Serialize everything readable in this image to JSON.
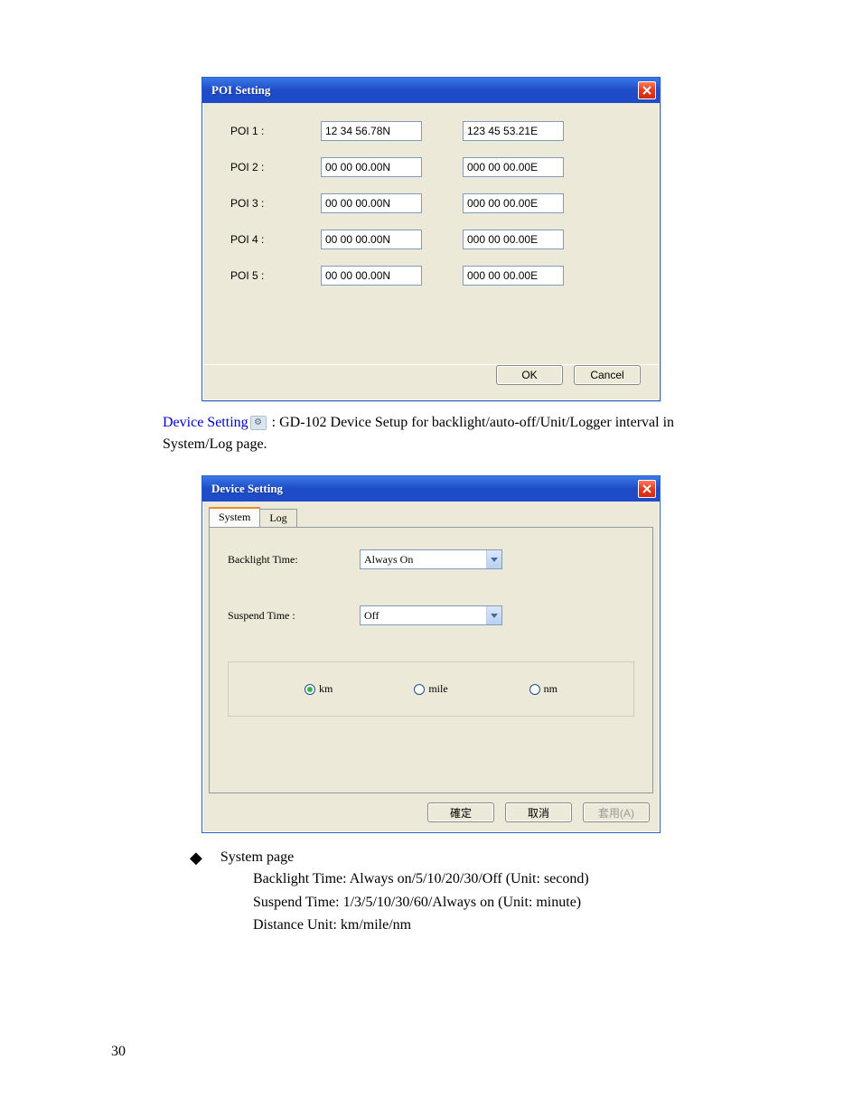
{
  "poi_dialog": {
    "title": "POI Setting",
    "rows": [
      {
        "label": "POI 1 :",
        "lat": "12 34 56.78N",
        "lon": "123 45 53.21E"
      },
      {
        "label": "POI 2 :",
        "lat": "00 00 00.00N",
        "lon": "000 00 00.00E"
      },
      {
        "label": "POI 3 :",
        "lat": "00 00 00.00N",
        "lon": "000 00 00.00E"
      },
      {
        "label": "POI 4 :",
        "lat": "00 00 00.00N",
        "lon": "000 00 00.00E"
      },
      {
        "label": "POI 5 :",
        "lat": "00 00 00.00N",
        "lon": "000 00 00.00E"
      }
    ],
    "ok": "OK",
    "cancel": "Cancel"
  },
  "desc1_link": "Device Setting",
  "desc1_rest": " : GD-102 Device Setup for backlight/auto-off/Unit/Logger interval in System/Log page.",
  "device_dialog": {
    "title": "Device Setting",
    "tab_system": "System",
    "tab_log": "Log",
    "backlight_label": "Backlight Time:",
    "backlight_value": "Always On",
    "suspend_label": "Suspend Time :",
    "suspend_value": "Off",
    "unit_km": "km",
    "unit_mile": "mile",
    "unit_nm": "nm",
    "btn_ok": "確定",
    "btn_cancel": "取消",
    "btn_apply": "套用(A)"
  },
  "bullet": {
    "heading": "System page",
    "line1": "Backlight Time: Always on/5/10/20/30/Off (Unit: second)",
    "line2": "Suspend Time: 1/3/5/10/30/60/Always on (Unit: minute)",
    "line3": "Distance Unit: km/mile/nm"
  },
  "page_number": "30"
}
